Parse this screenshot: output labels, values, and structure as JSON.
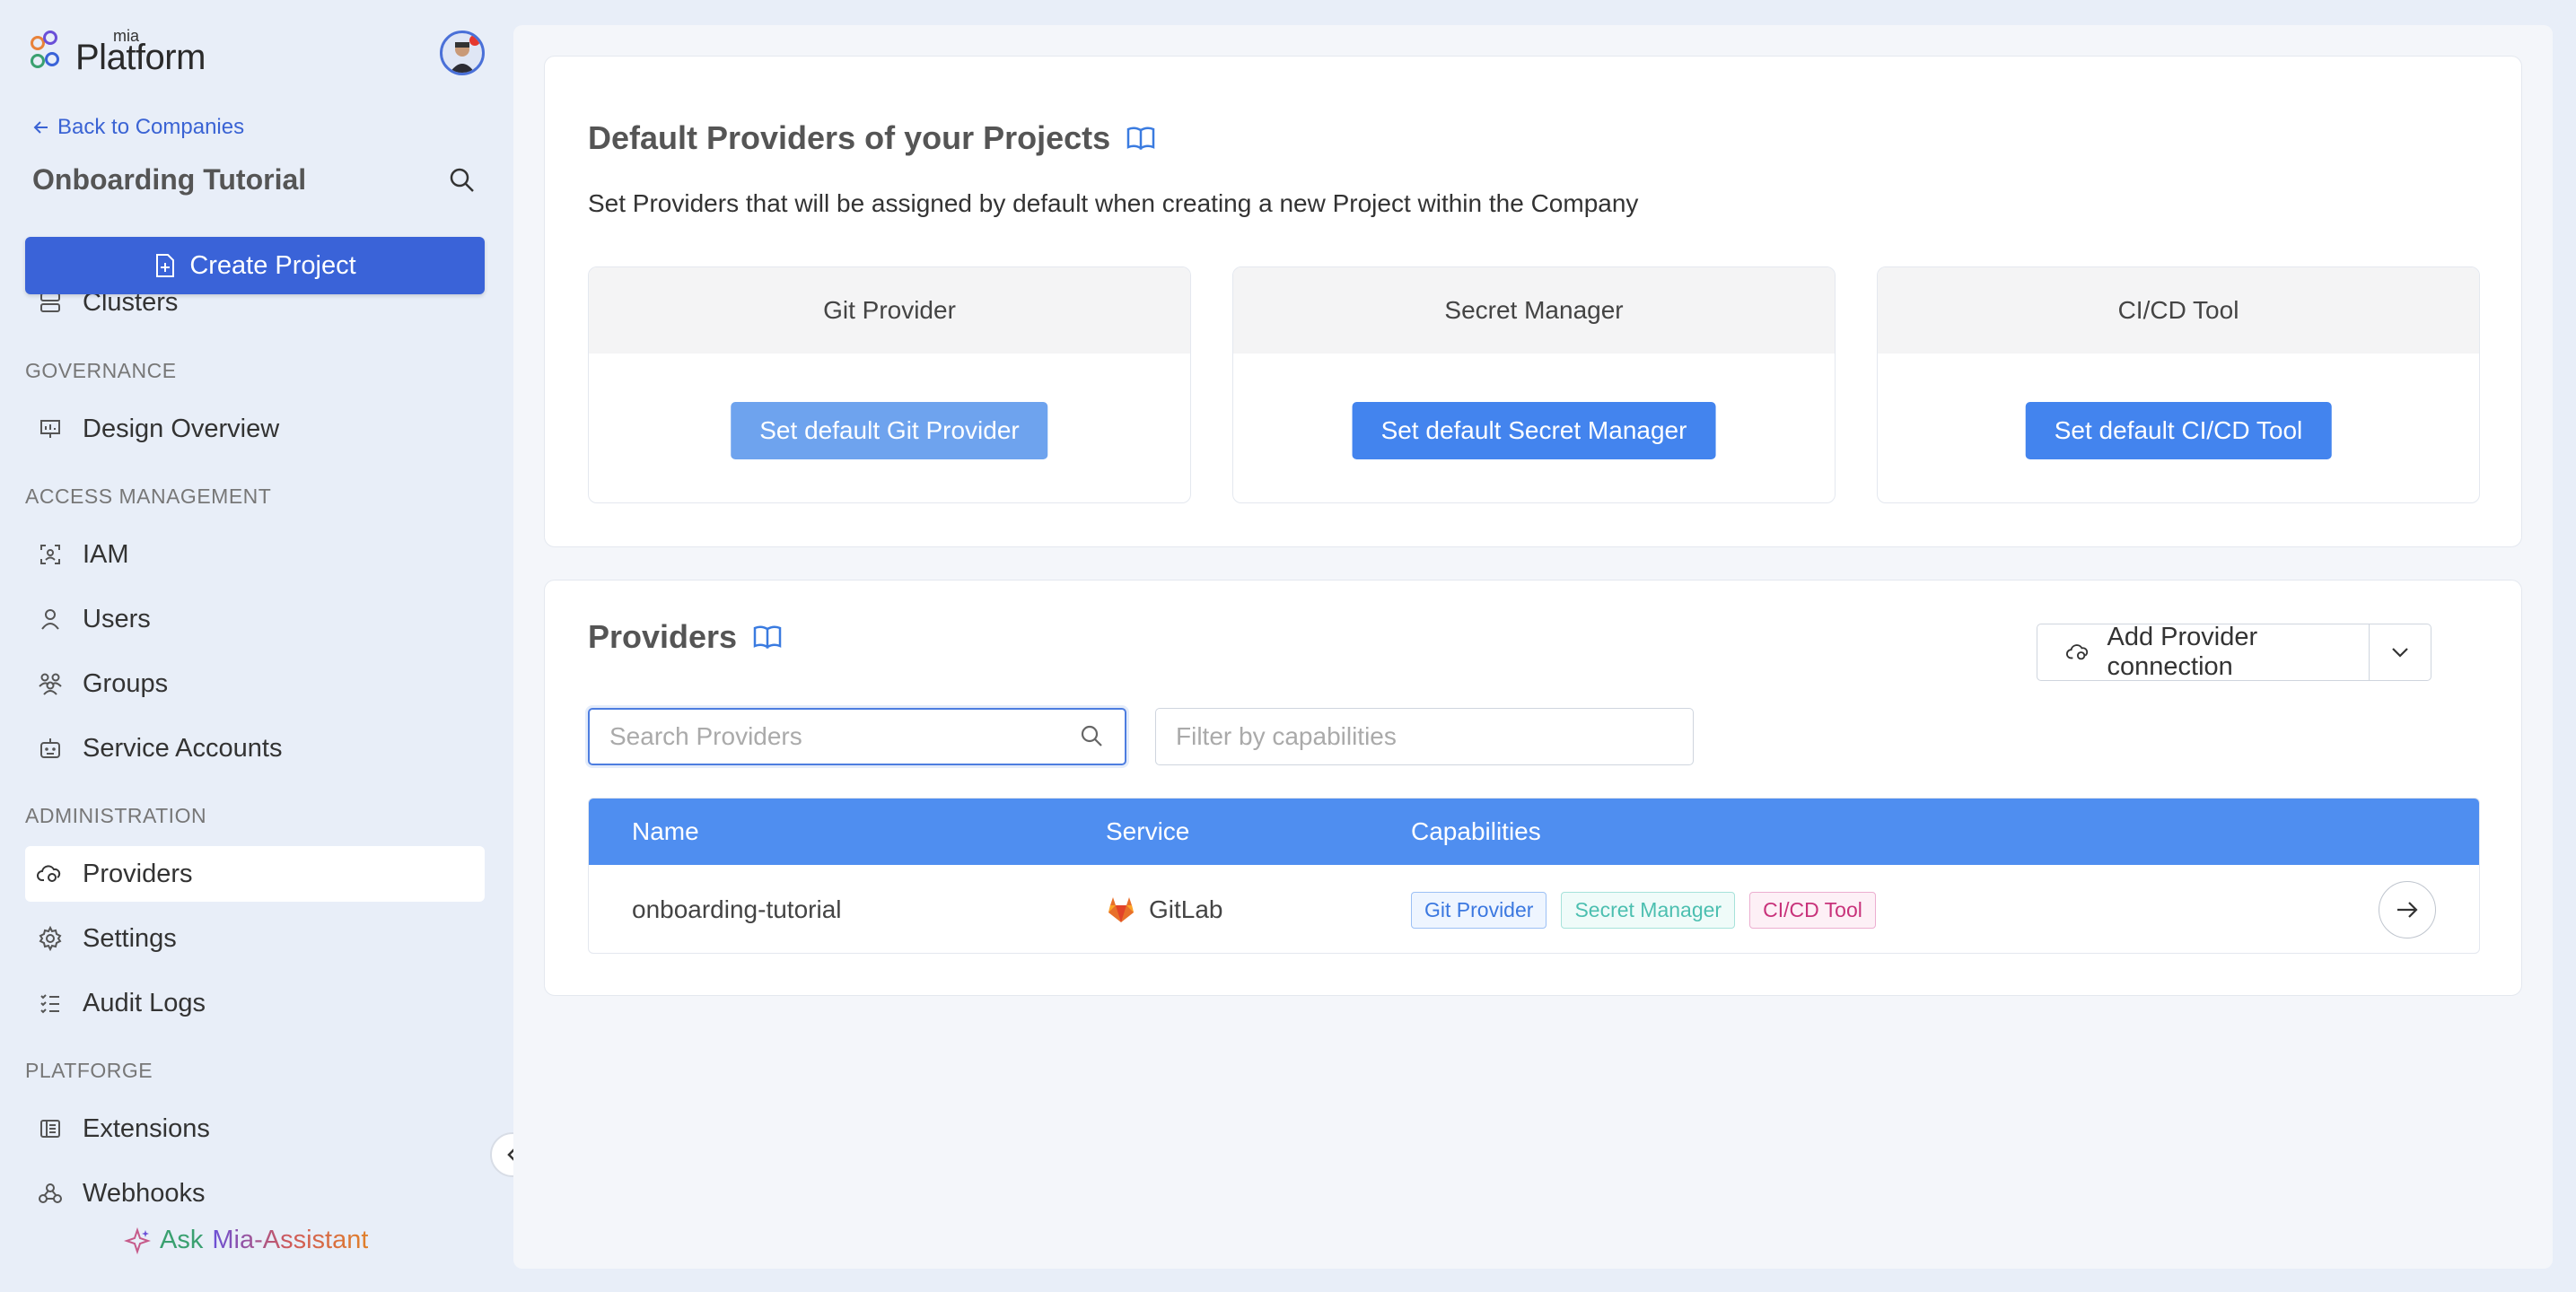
{
  "sidebar": {
    "logo_small": "mia",
    "logo_big": "Platform",
    "back_label": "Back to Companies",
    "company_name": "Onboarding Tutorial",
    "create_label": "Create Project",
    "partial_item": "Clusters",
    "sections": {
      "governance": "GOVERNANCE",
      "access": "ACCESS MANAGEMENT",
      "admin": "ADMINISTRATION",
      "platforge": "PLATFORGE"
    },
    "items": {
      "design_overview": "Design Overview",
      "iam": "IAM",
      "users": "Users",
      "groups": "Groups",
      "service_accounts": "Service Accounts",
      "providers": "Providers",
      "settings": "Settings",
      "audit_logs": "Audit Logs",
      "extensions": "Extensions",
      "webhooks": "Webhooks"
    },
    "ask_prefix": "Ask",
    "ask_name": "Mia-Assistant"
  },
  "defaults": {
    "title": "Default Providers of your Projects",
    "description": "Set Providers that will be assigned by default when creating a new Project within the Company",
    "boxes": [
      {
        "header": "Git Provider",
        "button": "Set default Git Provider"
      },
      {
        "header": "Secret Manager",
        "button": "Set default Secret Manager"
      },
      {
        "header": "CI/CD Tool",
        "button": "Set default CI/CD Tool"
      }
    ]
  },
  "providers": {
    "title": "Providers",
    "add_label": "Add Provider connection",
    "search_placeholder": "Search Providers",
    "filter_placeholder": "Filter by capabilities",
    "columns": {
      "name": "Name",
      "service": "Service",
      "capabilities": "Capabilities"
    },
    "rows": [
      {
        "name": "onboarding-tutorial",
        "service": "GitLab",
        "capabilities": [
          "Git Provider",
          "Secret Manager",
          "CI/CD Tool"
        ]
      }
    ]
  },
  "colors": {
    "primary": "#3a63d8",
    "table_header": "#4f8ef0",
    "tag_blue": "#3b78e0",
    "tag_teal": "#4cbfb0",
    "tag_pink": "#c8327a"
  }
}
